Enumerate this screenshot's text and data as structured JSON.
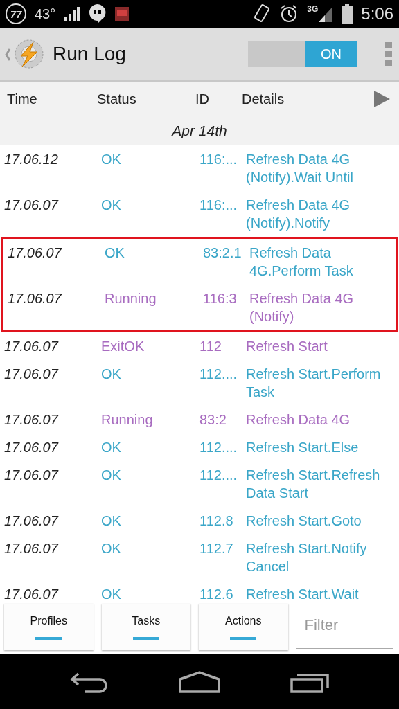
{
  "status_bar": {
    "notification_count": "77",
    "temperature": "43°",
    "network": "3G",
    "time": "5:06"
  },
  "header": {
    "title": "Run Log",
    "toggle": {
      "label": "ON",
      "on": true
    }
  },
  "columns": [
    "Time",
    "Status",
    "ID",
    "Details"
  ],
  "date": "Apr 14th",
  "rows": [
    {
      "time": "17.06.12",
      "status": "OK",
      "id": "116:...",
      "details": "Refresh Data 4G (Notify).Wait Until",
      "color": "#3aa6c8",
      "highlighted": false
    },
    {
      "time": "17.06.07",
      "status": "OK",
      "id": "116:...",
      "details": "Refresh Data 4G (Notify).Notify",
      "color": "#3aa6c8",
      "highlighted": false
    },
    {
      "time": "17.06.07",
      "status": "OK",
      "id": "83:2.1",
      "details": "Refresh Data 4G.Perform Task",
      "color": "#3aa6c8",
      "highlighted": true
    },
    {
      "time": "17.06.07",
      "status": "Running",
      "id": "116:3",
      "details": "Refresh Data 4G (Notify)",
      "color": "#a86cc0",
      "highlighted": true
    },
    {
      "time": "17.06.07",
      "status": "ExitOK",
      "id": "112",
      "details": "Refresh Start",
      "color": "#a86cc0",
      "highlighted": false
    },
    {
      "time": "17.06.07",
      "status": "OK",
      "id": "112....",
      "details": "Refresh Start.Perform Task",
      "color": "#3aa6c8",
      "highlighted": false
    },
    {
      "time": "17.06.07",
      "status": "Running",
      "id": "83:2",
      "details": "Refresh Data 4G",
      "color": "#a86cc0",
      "highlighted": false
    },
    {
      "time": "17.06.07",
      "status": "OK",
      "id": "112....",
      "details": "Refresh Start.Else",
      "color": "#3aa6c8",
      "highlighted": false
    },
    {
      "time": "17.06.07",
      "status": "OK",
      "id": "112....",
      "details": "Refresh Start.Refresh Data Start",
      "color": "#3aa6c8",
      "highlighted": false
    },
    {
      "time": "17.06.07",
      "status": "OK",
      "id": "112.8",
      "details": "Refresh Start.Goto",
      "color": "#3aa6c8",
      "highlighted": false
    },
    {
      "time": "17.06.07",
      "status": "OK",
      "id": "112.7",
      "details": "Refresh Start.Notify Cancel",
      "color": "#3aa6c8",
      "highlighted": false
    },
    {
      "time": "17.06.07",
      "status": "OK",
      "id": "112.6",
      "details": "Refresh Start.Wait",
      "color": "#3aa6c8",
      "highlighted": false
    }
  ],
  "bottom_tabs": [
    "Profiles",
    "Tasks",
    "Actions"
  ],
  "filter": {
    "placeholder": "Filter"
  }
}
